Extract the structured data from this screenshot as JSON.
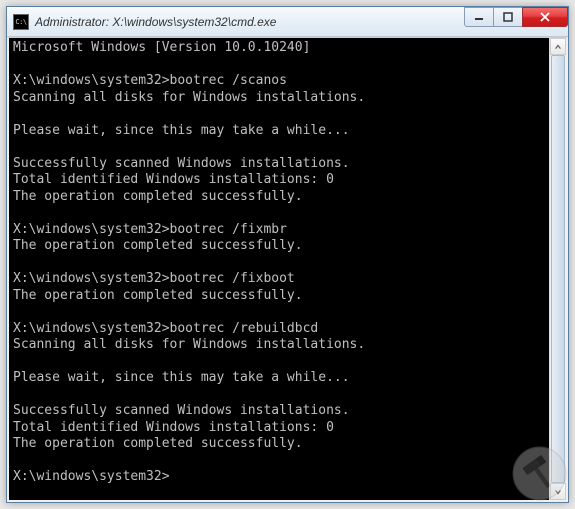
{
  "titlebar": {
    "icon_label": "C:\\",
    "title": "Administrator: X:\\windows\\system32\\cmd.exe"
  },
  "controls": {
    "minimize": "minimize",
    "maximize": "maximize",
    "close": "close"
  },
  "console": {
    "lines": [
      "Microsoft Windows [Version 10.0.10240]",
      "",
      "X:\\windows\\system32>bootrec /scanos",
      "Scanning all disks for Windows installations.",
      "",
      "Please wait, since this may take a while...",
      "",
      "Successfully scanned Windows installations.",
      "Total identified Windows installations: 0",
      "The operation completed successfully.",
      "",
      "X:\\windows\\system32>bootrec /fixmbr",
      "The operation completed successfully.",
      "",
      "X:\\windows\\system32>bootrec /fixboot",
      "The operation completed successfully.",
      "",
      "X:\\windows\\system32>bootrec /rebuildbcd",
      "Scanning all disks for Windows installations.",
      "",
      "Please wait, since this may take a while...",
      "",
      "Successfully scanned Windows installations.",
      "Total identified Windows installations: 0",
      "The operation completed successfully.",
      "",
      "X:\\windows\\system32>"
    ]
  }
}
